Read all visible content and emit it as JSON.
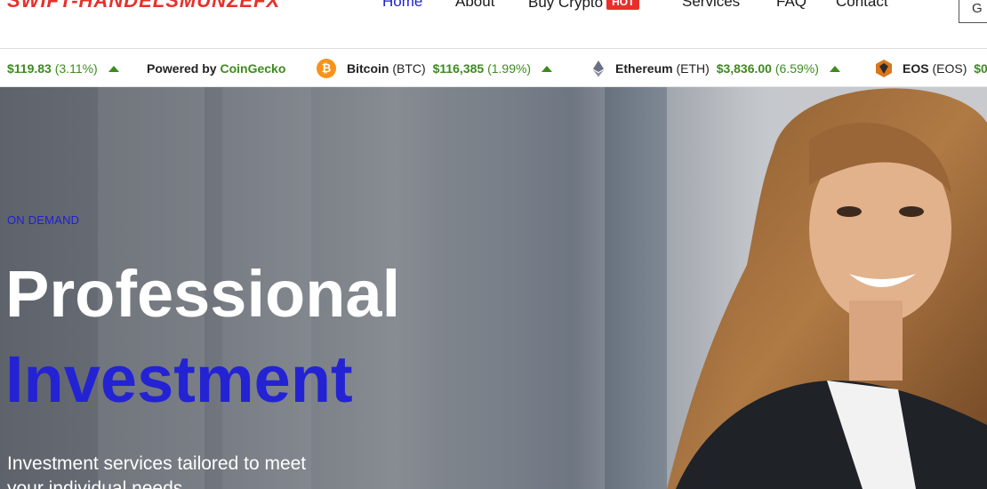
{
  "brand": {
    "logo_text": "SWIFT-HANDELSMUNZEFX"
  },
  "nav": {
    "items": [
      {
        "label": "Home",
        "active": true
      },
      {
        "label": "About"
      },
      {
        "label": "Buy Crypto",
        "badge": "HOT"
      },
      {
        "label": "Services"
      },
      {
        "label": "FAQ"
      },
      {
        "label": "Contact"
      }
    ],
    "cta_label": "G"
  },
  "ticker": {
    "first_price": "$119.83",
    "first_change": "(3.11%)",
    "powered_prefix": "Powered by",
    "powered_brand": "CoinGecko",
    "coins": [
      {
        "name": "Bitcoin",
        "symbol": "(BTC)",
        "price": "$116,385",
        "change": "(1.99%)",
        "icon": "bitcoin-icon"
      },
      {
        "name": "Ethereum",
        "symbol": "(ETH)",
        "price": "$3,836.00",
        "change": "(6.59%)",
        "icon": "ethereum-icon"
      },
      {
        "name": "EOS",
        "symbol": "(EOS)",
        "price": "$0",
        "icon": "eos-icon"
      }
    ],
    "colors": {
      "up": "#3d8b1e"
    }
  },
  "hero": {
    "eyebrow": "ON DEMAND",
    "title_line1": "Professional",
    "title_line2": "Investment",
    "description": "Investment services tailored to meet your individual needs"
  },
  "colors": {
    "accent": "#1e1ed6",
    "logo": "#e8302b",
    "hot_badge": "#e8302b"
  }
}
